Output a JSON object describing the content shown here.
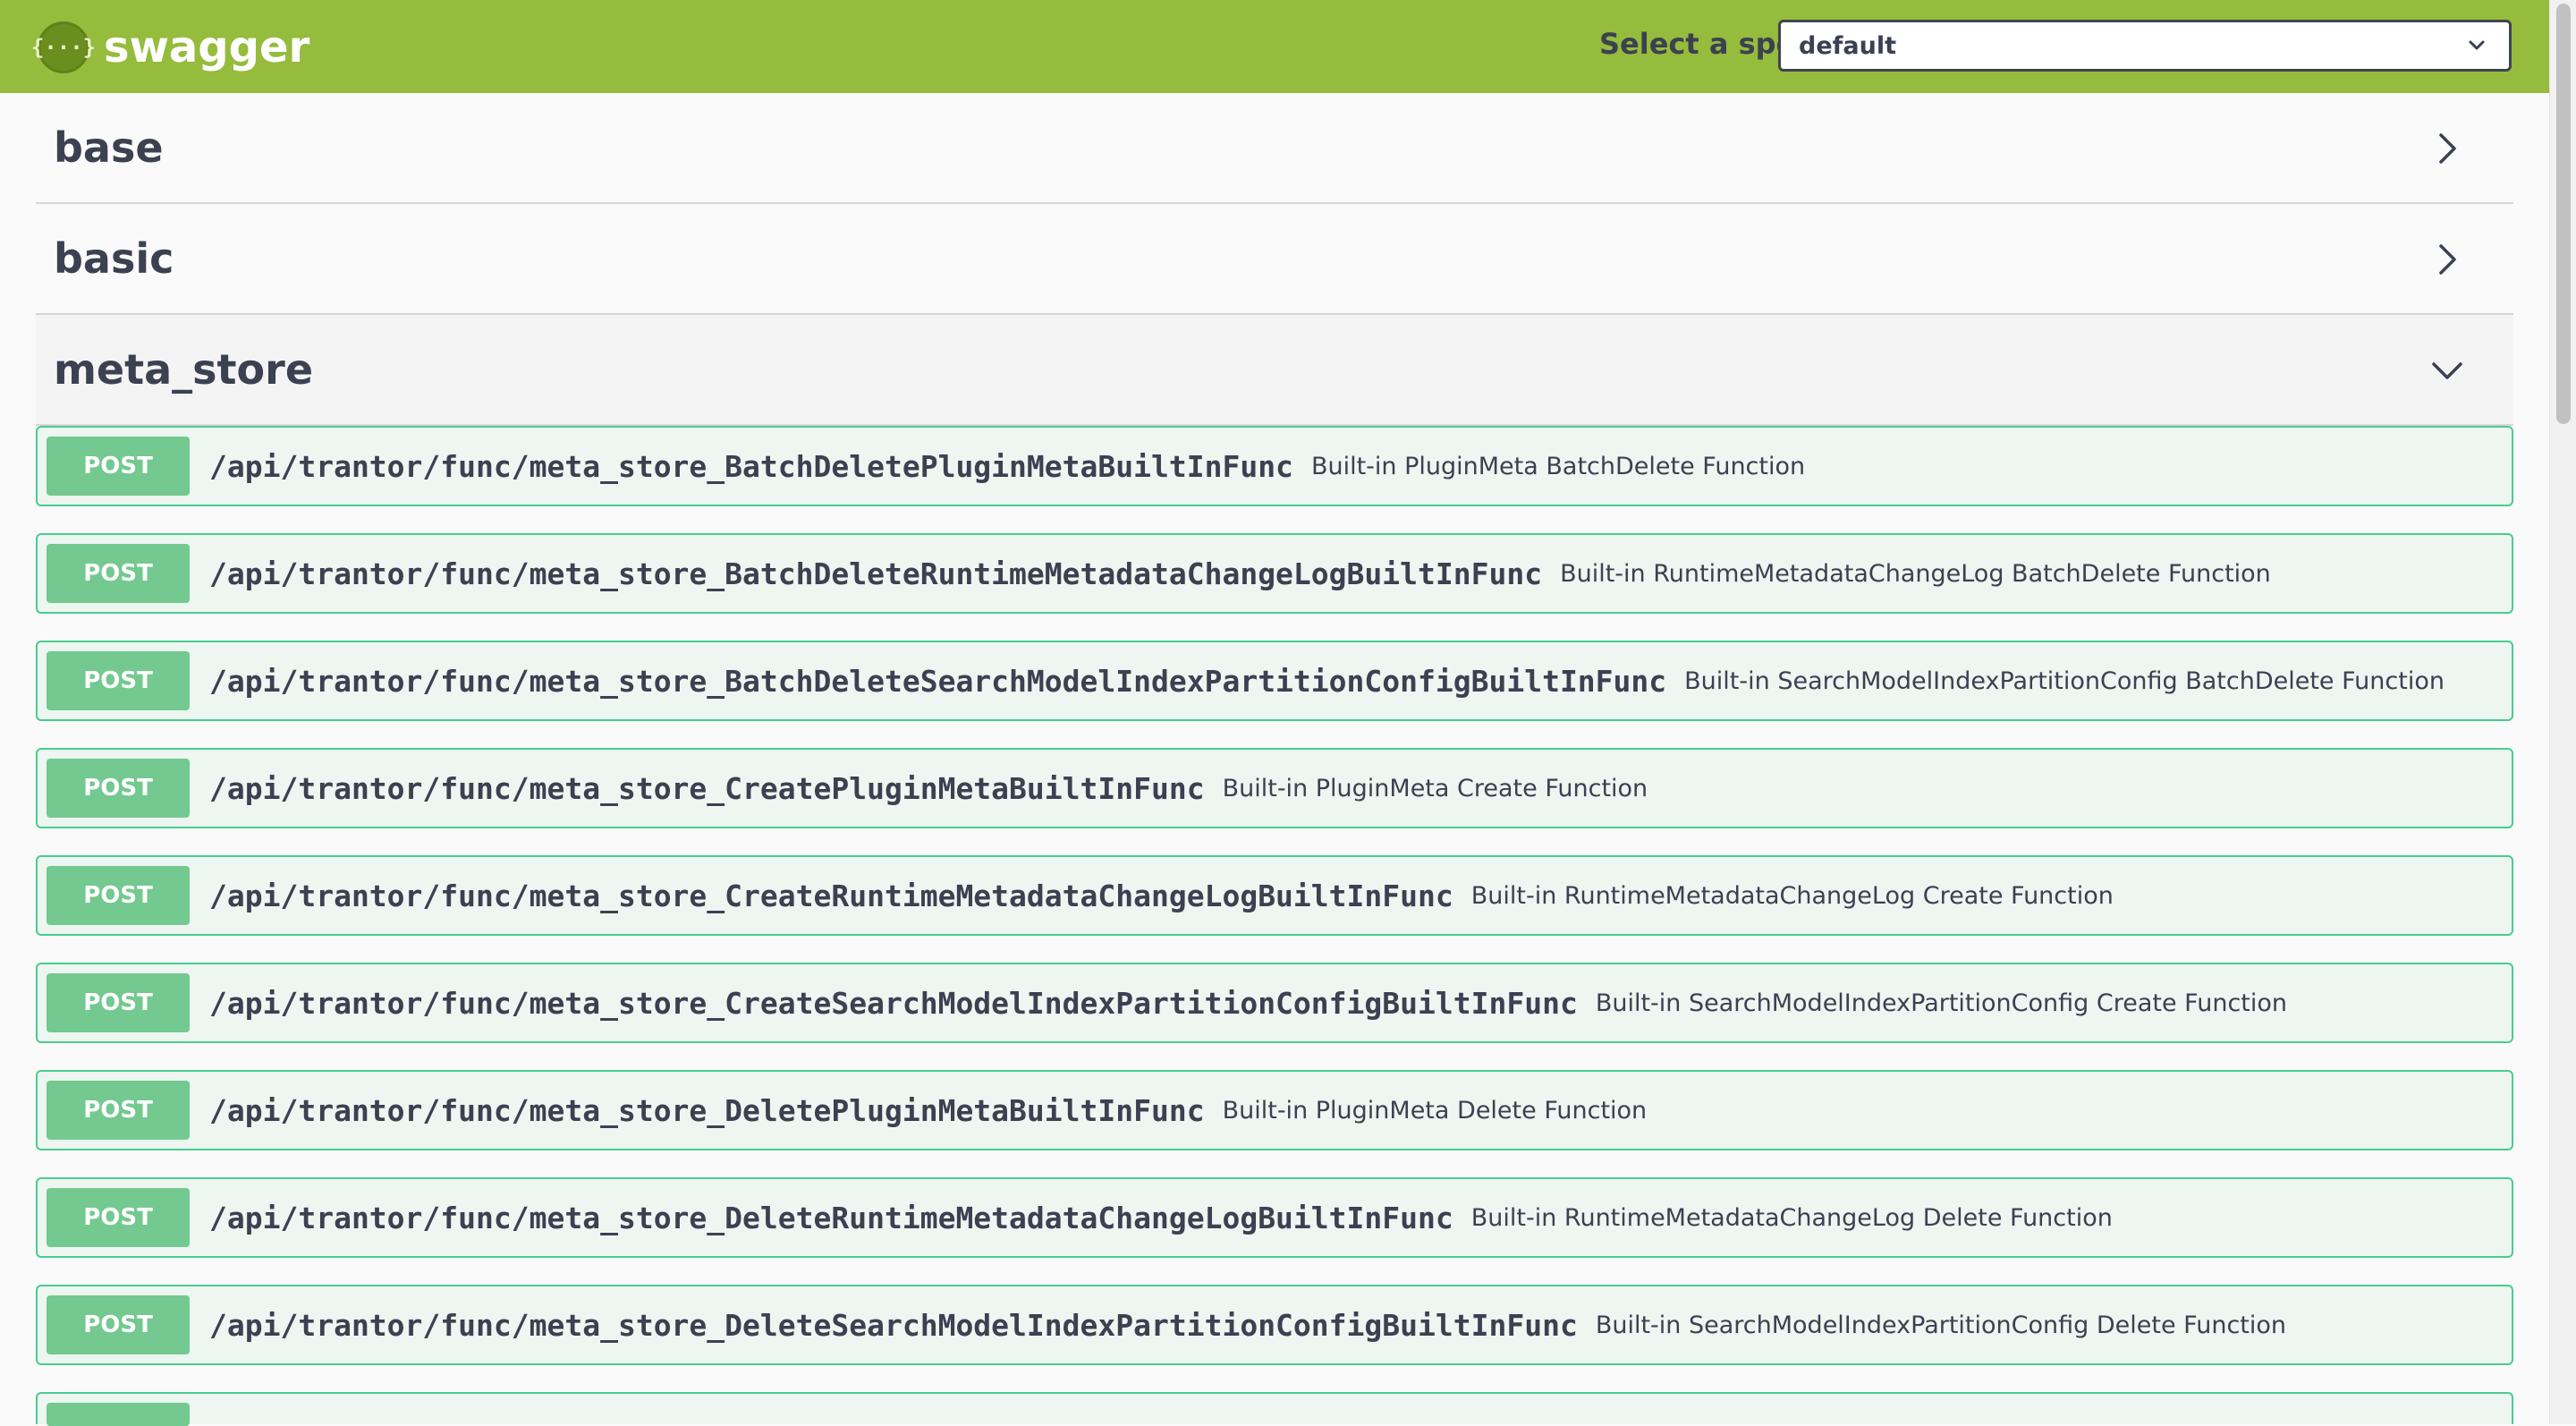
{
  "header": {
    "logo_glyph": "{···}",
    "logo_text": "swagger",
    "spec_label": "Select a spec",
    "spec_selected": "default",
    "bar_color": "#95bc3c"
  },
  "tags": [
    {
      "name": "base",
      "state": "collapsed"
    },
    {
      "name": "basic",
      "state": "collapsed"
    },
    {
      "name": "meta_store",
      "state": "expanded"
    }
  ],
  "operations": [
    {
      "method": "POST",
      "path": "/api/trantor/func/meta_store_BatchDeletePluginMetaBuiltInFunc",
      "summary": "Built-in PluginMeta BatchDelete Function"
    },
    {
      "method": "POST",
      "path": "/api/trantor/func/meta_store_BatchDeleteRuntimeMetadataChangeLogBuiltInFunc",
      "summary": "Built-in RuntimeMetadataChangeLog BatchDelete Function"
    },
    {
      "method": "POST",
      "path": "/api/trantor/func/meta_store_BatchDeleteSearchModelIndexPartitionConfigBuiltInFunc",
      "summary": "Built-in SearchModelIndexPartitionConfig BatchDelete Function"
    },
    {
      "method": "POST",
      "path": "/api/trantor/func/meta_store_CreatePluginMetaBuiltInFunc",
      "summary": "Built-in PluginMeta Create Function"
    },
    {
      "method": "POST",
      "path": "/api/trantor/func/meta_store_CreateRuntimeMetadataChangeLogBuiltInFunc",
      "summary": "Built-in RuntimeMetadataChangeLog Create Function"
    },
    {
      "method": "POST",
      "path": "/api/trantor/func/meta_store_CreateSearchModelIndexPartitionConfigBuiltInFunc",
      "summary": "Built-in SearchModelIndexPartitionConfig Create Function"
    },
    {
      "method": "POST",
      "path": "/api/trantor/func/meta_store_DeletePluginMetaBuiltInFunc",
      "summary": "Built-in PluginMeta Delete Function"
    },
    {
      "method": "POST",
      "path": "/api/trantor/func/meta_store_DeleteRuntimeMetadataChangeLogBuiltInFunc",
      "summary": "Built-in RuntimeMetadataChangeLog Delete Function"
    },
    {
      "method": "POST",
      "path": "/api/trantor/func/meta_store_DeleteSearchModelIndexPartitionConfigBuiltInFunc",
      "summary": "Built-in SearchModelIndexPartitionConfig Delete Function"
    }
  ],
  "colors": {
    "post_border": "#49cc90",
    "post_bg": "#edf6f0",
    "post_badge": "#73c98f"
  }
}
